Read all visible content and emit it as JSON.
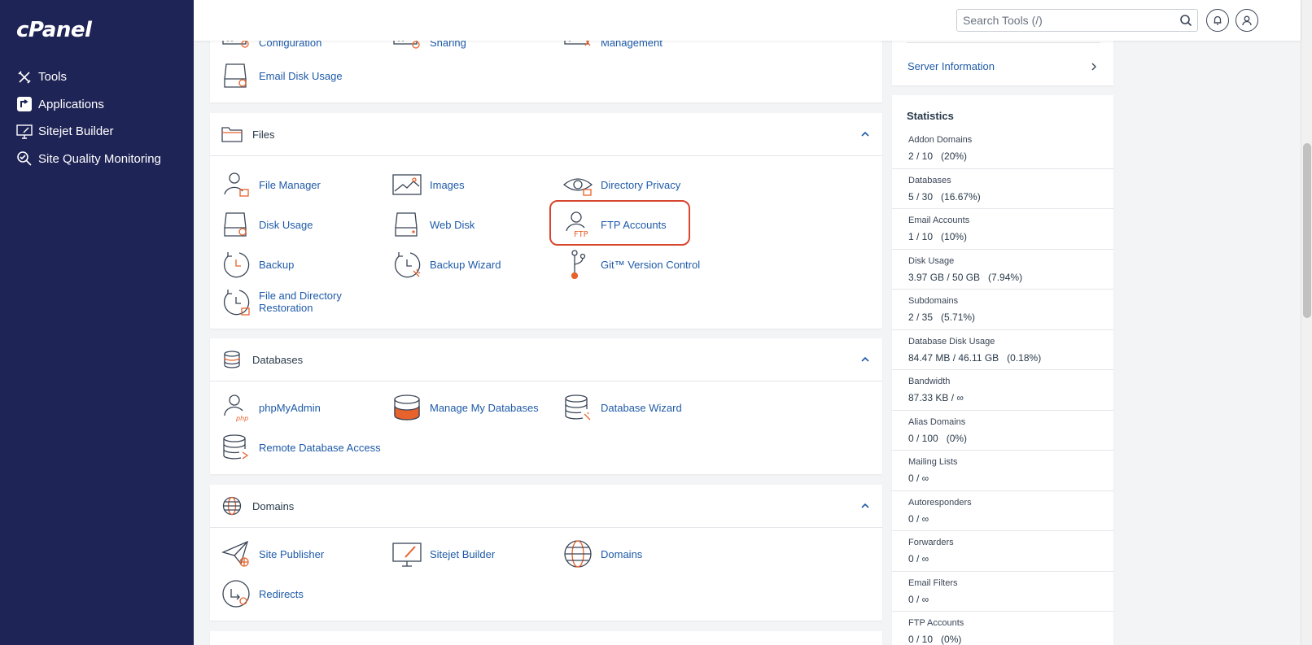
{
  "sidebar": {
    "logo": "cPanel",
    "items": [
      {
        "label": "Tools",
        "icon": "tools-icon"
      },
      {
        "label": "Applications",
        "icon": "applications-icon"
      },
      {
        "label": "Sitejet Builder",
        "icon": "sitejet-icon"
      },
      {
        "label": "Site Quality Monitoring",
        "icon": "monitoring-icon"
      }
    ]
  },
  "topbar": {
    "search_placeholder": "Search Tools (/)"
  },
  "email_section": {
    "items": [
      {
        "label": "Configuration",
        "icon": "configuration-icon"
      },
      {
        "label": "Sharing",
        "icon": "sharing-icon"
      },
      {
        "label": "Management",
        "icon": "management-icon"
      },
      {
        "label": "Email Disk Usage",
        "icon": "email-disk-usage-icon"
      }
    ]
  },
  "files": {
    "title": "Files",
    "items": [
      {
        "label": "File Manager"
      },
      {
        "label": "Images"
      },
      {
        "label": "Directory Privacy"
      },
      {
        "label": "Disk Usage"
      },
      {
        "label": "Web Disk"
      },
      {
        "label": "FTP Accounts"
      },
      {
        "label": "Backup"
      },
      {
        "label": "Backup Wizard"
      },
      {
        "label": "Git™ Version Control"
      },
      {
        "label_line1": "File and Directory",
        "label_line2": "Restoration"
      }
    ]
  },
  "databases": {
    "title": "Databases",
    "items": [
      {
        "label": "phpMyAdmin"
      },
      {
        "label": "Manage My Databases"
      },
      {
        "label": "Database Wizard"
      },
      {
        "label": "Remote Database Access"
      }
    ]
  },
  "domains": {
    "title": "Domains",
    "items": [
      {
        "label": "Site Publisher"
      },
      {
        "label": "Sitejet Builder"
      },
      {
        "label": "Domains"
      },
      {
        "label": "Redirects"
      }
    ]
  },
  "right": {
    "server_information": "Server Information",
    "statistics_title": "Statistics",
    "stats": [
      {
        "label": "Addon Domains",
        "value": "2 / 10   (20%)"
      },
      {
        "label": "Databases",
        "value": "5 / 30   (16.67%)"
      },
      {
        "label": "Email Accounts",
        "value": "1 / 10   (10%)"
      },
      {
        "label": "Disk Usage",
        "value": "3.97 GB / 50 GB   (7.94%)"
      },
      {
        "label": "Subdomains",
        "value": "2 / 35   (5.71%)"
      },
      {
        "label": "Database Disk Usage",
        "value": "84.47 MB / 46.11 GB   (0.18%)"
      },
      {
        "label": "Bandwidth",
        "value": "87.33 KB / ∞"
      },
      {
        "label": "Alias Domains",
        "value": "0 / 100   (0%)"
      },
      {
        "label": "Mailing Lists",
        "value": "0 / ∞"
      },
      {
        "label": "Autoresponders",
        "value": "0 / ∞"
      },
      {
        "label": "Forwarders",
        "value": "0 / ∞"
      },
      {
        "label": "Email Filters",
        "value": "0 / ∞"
      },
      {
        "label": "FTP Accounts",
        "value": "0 / 10   (0%)"
      }
    ]
  },
  "colors": {
    "sidebar_bg": "#1f2456",
    "link": "#1e5aa8",
    "accent_orange": "#e8622c",
    "highlight_red": "#d8452e"
  }
}
